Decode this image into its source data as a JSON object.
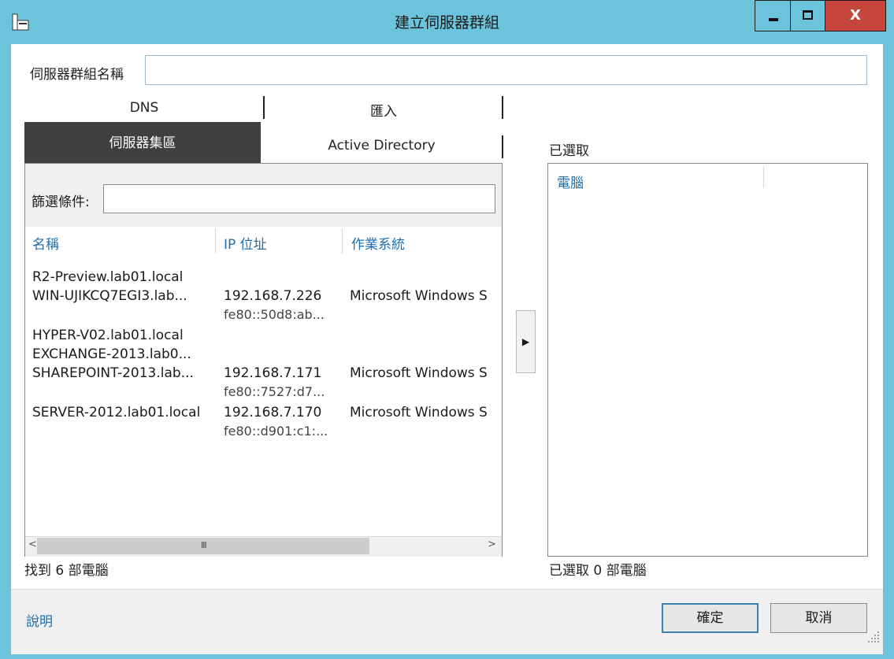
{
  "window": {
    "title": "建立伺服器群組"
  },
  "server_group_name": {
    "label": "伺服器群組名稱",
    "value": ""
  },
  "tabs_top": [
    "DNS",
    "匯入"
  ],
  "tabs_bottom": [
    "伺服器集區",
    "Active Directory"
  ],
  "filter": {
    "label": "篩選條件:",
    "value": ""
  },
  "columns": [
    "名稱",
    "IP 位址",
    "作業系統"
  ],
  "rows": [
    {
      "name": "R2-Preview.lab01.local",
      "ip": "",
      "ip2": "",
      "os": ""
    },
    {
      "name": "WIN-UJIKCQ7EGI3.lab...",
      "ip": "192.168.7.226",
      "ip2": "fe80::50d8:ab...",
      "os": "Microsoft Windows S"
    },
    {
      "name": "HYPER-V02.lab01.local",
      "ip": "",
      "ip2": "",
      "os": ""
    },
    {
      "name": "EXCHANGE-2013.lab0...",
      "ip": "",
      "ip2": "",
      "os": ""
    },
    {
      "name": "SHAREPOINT-2013.lab...",
      "ip": "192.168.7.171",
      "ip2": "fe80::7527:d7...",
      "os": "Microsoft Windows S"
    },
    {
      "name": "SERVER-2012.lab01.local",
      "ip": "192.168.7.170",
      "ip2": "fe80::d901:c1:...",
      "os": "Microsoft Windows S"
    }
  ],
  "found_text": "找到 6 部電腦",
  "selected": {
    "heading": "已選取",
    "column": "電腦",
    "count_text": "已選取 0 部電腦"
  },
  "scrollbar": {
    "grip": "III",
    "left_arrow": "<",
    "right_arrow": ">"
  },
  "add_arrow": "▶",
  "footer": {
    "help": "說明",
    "ok": "確定",
    "cancel": "取消"
  },
  "colors": {
    "titlebar": "#6cc4dc",
    "close": "#c7463b",
    "link": "#1e6fb0",
    "tab_active": "#3f3f3f"
  }
}
